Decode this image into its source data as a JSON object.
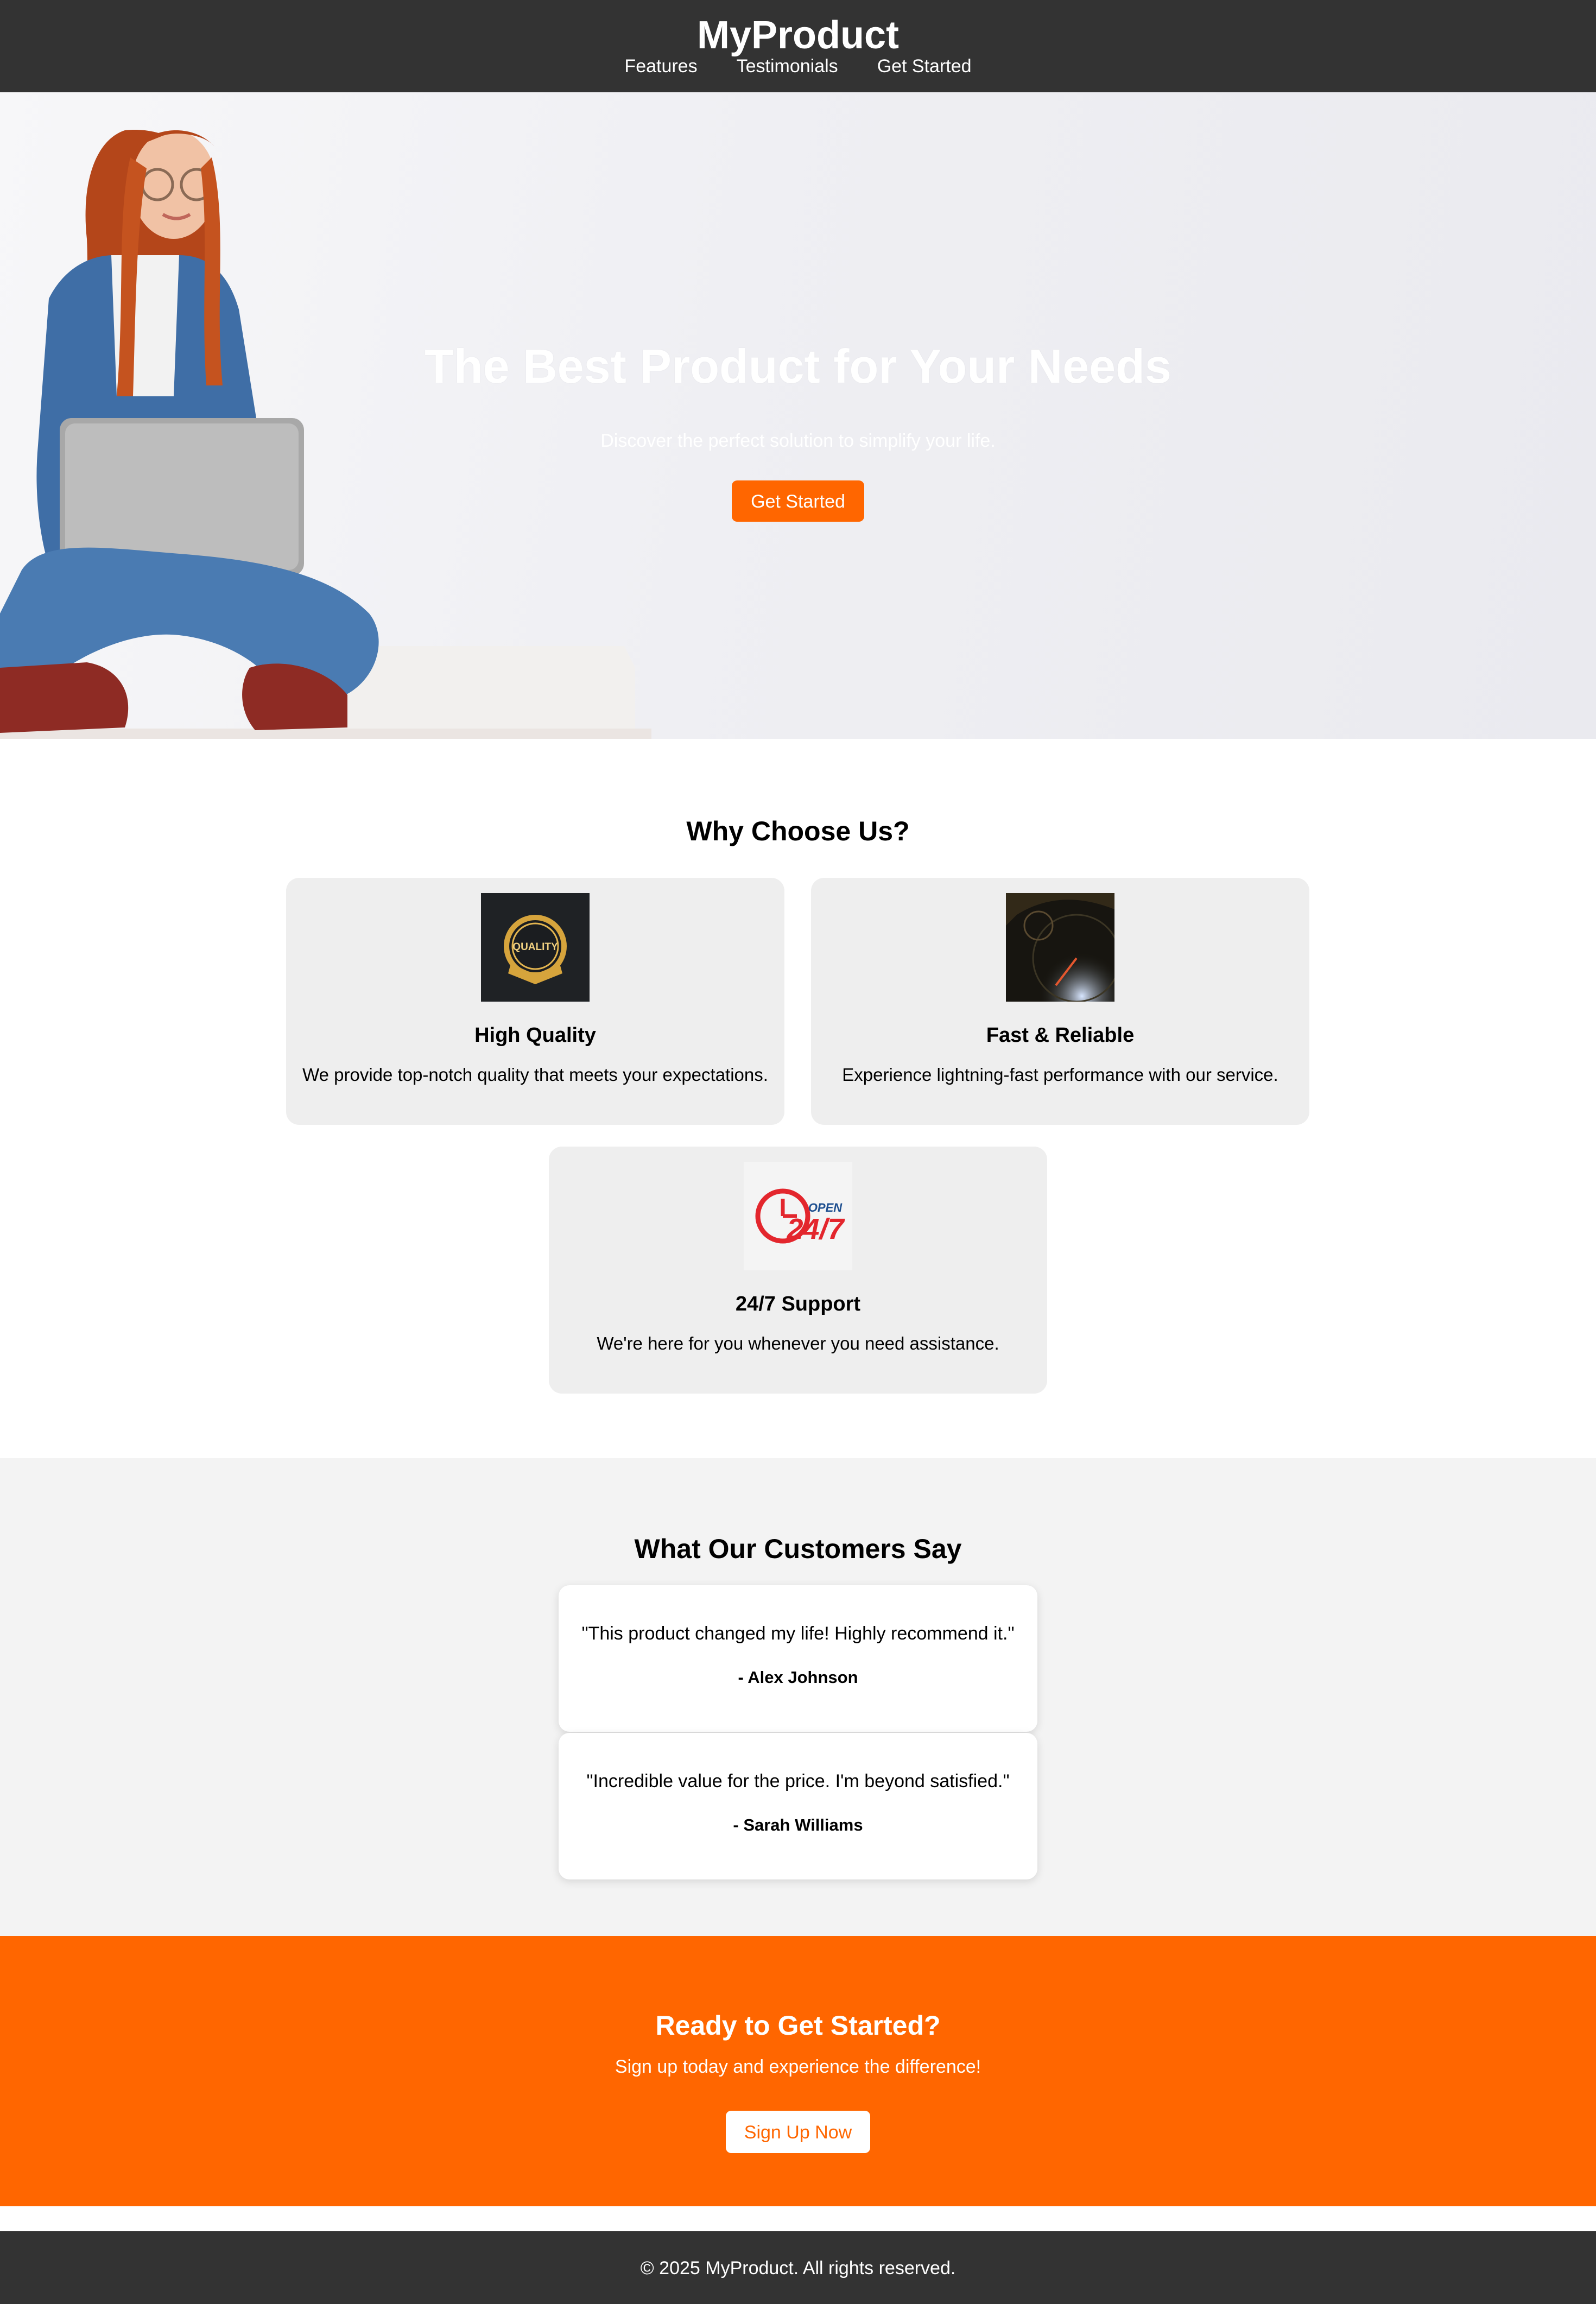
{
  "header": {
    "brand": "MyProduct",
    "nav": [
      "Features",
      "Testimonials",
      "Get Started"
    ]
  },
  "hero": {
    "title": "The Best Product for Your Needs",
    "subtitle": "Discover the perfect solution to simplify your life.",
    "cta_label": "Get Started"
  },
  "features": {
    "title": "Why Choose Us?",
    "items": [
      {
        "title": "High Quality",
        "text": "We provide top-notch quality that meets your expectations.",
        "icon": "quality-badge-image",
        "badge_text": "QUALITY"
      },
      {
        "title": "Fast & Reliable",
        "text": "Experience lightning-fast performance with our service.",
        "icon": "speedometer-image"
      },
      {
        "title": "24/7 Support",
        "text": "We're here for you whenever you need assistance.",
        "icon": "24-7-open-image",
        "badge_big": "24/7",
        "badge_small": "OPEN"
      }
    ]
  },
  "testimonials": {
    "title": "What Our Customers Say",
    "items": [
      {
        "quote": "\"This product changed my life! Highly recommend it.\"",
        "author": "- Alex Johnson"
      },
      {
        "quote": "\"Incredible value for the price. I'm beyond satisfied.\"",
        "author": "- Sarah Williams"
      }
    ]
  },
  "cta": {
    "title": "Ready to Get Started?",
    "text": "Sign up today and experience the difference!",
    "button_label": "Sign Up Now"
  },
  "footer": {
    "text": "© 2025 MyProduct. All rights reserved."
  },
  "colors": {
    "header_bg": "#333333",
    "accent": "#ff6600",
    "card_bg": "#eeeeee",
    "testimonials_bg": "#f3f3f3"
  }
}
